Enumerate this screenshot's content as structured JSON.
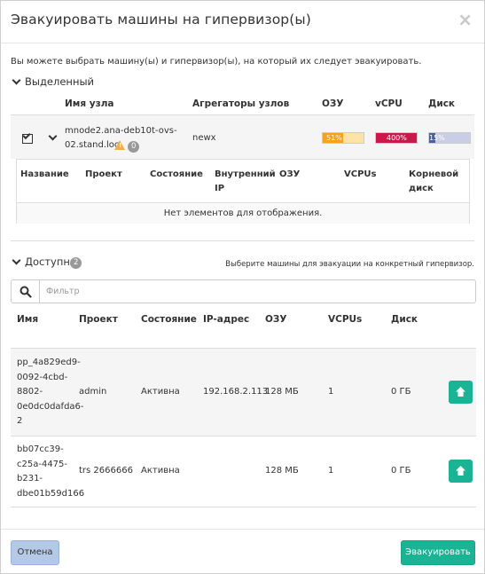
{
  "dialog": {
    "title": "Эвакуировать машины на гипервизор(ы)",
    "close_label": "×",
    "intro": "Вы можете выбрать машину(ы) и гипервизор(ы), на который их следует эвакуировать."
  },
  "selected": {
    "toggle_label": "Выделенный",
    "headers": {
      "node": "Имя узла",
      "aggregates": "Агрегаторы узлов",
      "ram": "ОЗУ",
      "vcpu": "vCPU",
      "disk": "Диск"
    },
    "row": {
      "node_line1": "mnode2.ana-deb10t-ovs-",
      "node_line2": "02.stand.loc",
      "warning_icon": "warning-icon",
      "badge": "0",
      "aggregate": "newx",
      "ram_label": "51%",
      "ram_pct": 51,
      "ram_color": "#f7a21b",
      "vcpu_label": "400%",
      "vcpu_pct": 100,
      "vcpu_color": "#c9184a",
      "disk_label": "15%",
      "disk_pct": 15,
      "disk_color": "#4a5f9c"
    },
    "detail_headers": {
      "name": "Название",
      "project": "Проект",
      "status": "Состояние",
      "internal_ip_1": "Внутренний",
      "internal_ip_2": "IP",
      "ram": "ОЗУ",
      "vcpus": "VCPUs",
      "root_disk_1": "Корневой",
      "root_disk_2": "диск"
    },
    "empty_text": "Нет элементов для отображения."
  },
  "available": {
    "toggle_label": "Доступно",
    "badge": "2",
    "hint": "Выберите машины для эвакуации на конкретный гипервизор.",
    "filter_placeholder": "Фильтр",
    "headers": {
      "name": "Имя",
      "project": "Проект",
      "status": "Состояние",
      "ip": "IP-адрес",
      "ram": "ОЗУ",
      "vcpus": "VCPUs",
      "disk": "Диск"
    },
    "rows": [
      {
        "name_lines": [
          "pp_4a829ed9-",
          "0092-4cbd-",
          "8802-",
          "0e0dc0dafda6-",
          "2"
        ],
        "project": "admin",
        "status": "Активна",
        "ip": "192.168.2.113",
        "ram": "128 МБ",
        "vcpus": "1",
        "disk": "0 ГБ"
      },
      {
        "name_lines": [
          "bb07cc39-",
          "c25a-4475-",
          "b231-",
          "dbe01b59d166"
        ],
        "project": "trs 2666666",
        "status": "Активна",
        "ip": "",
        "ram": "128 МБ",
        "vcpus": "1",
        "disk": "0 ГБ"
      }
    ]
  },
  "footer": {
    "cancel_label": "Отмена",
    "evacuate_label": "Эвакуировать"
  },
  "colors": {
    "accent": "#1ab394",
    "cancel_bg": "#b4c9e6"
  }
}
